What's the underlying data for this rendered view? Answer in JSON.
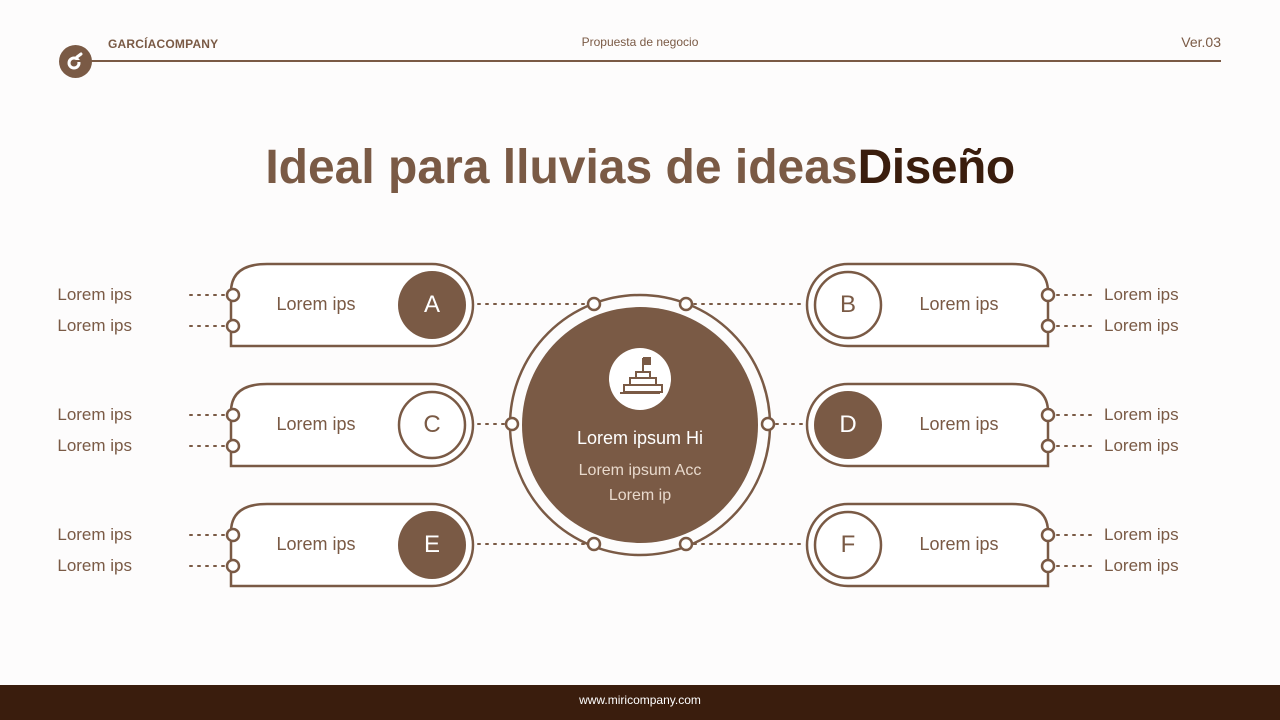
{
  "header": {
    "brand": "GARCÍACOMPANY",
    "subtitle": "Propuesta de negocio",
    "version": "Ver.03"
  },
  "title": {
    "part1": "Ideal para lluvias de ideas",
    "part2": "Diseño"
  },
  "center": {
    "title": "Lorem ipsum Hi",
    "line1": "Lorem ipsum Acc",
    "line2": "Lorem ip",
    "icon": "podium-flag-icon"
  },
  "nodes": [
    {
      "letter": "A",
      "label": "Lorem ips",
      "items": [
        "Lorem ips",
        "Lorem ips"
      ],
      "filled": true
    },
    {
      "letter": "B",
      "label": "Lorem ips",
      "items": [
        "Lorem ips",
        "Lorem ips"
      ],
      "filled": false
    },
    {
      "letter": "C",
      "label": "Lorem ips",
      "items": [
        "Lorem ips",
        "Lorem ips"
      ],
      "filled": false
    },
    {
      "letter": "D",
      "label": "Lorem ips",
      "items": [
        "Lorem ips",
        "Lorem ips"
      ],
      "filled": true
    },
    {
      "letter": "E",
      "label": "Lorem ips",
      "items": [
        "Lorem ips",
        "Lorem ips"
      ],
      "filled": true
    },
    {
      "letter": "F",
      "label": "Lorem ips",
      "items": [
        "Lorem ips",
        "Lorem ips"
      ],
      "filled": false
    }
  ],
  "colors": {
    "primary": "#7a5a45",
    "dark": "#3a1d0d",
    "background": "#fdfcfc"
  },
  "footer": {
    "url": "www.miricompany.com"
  }
}
